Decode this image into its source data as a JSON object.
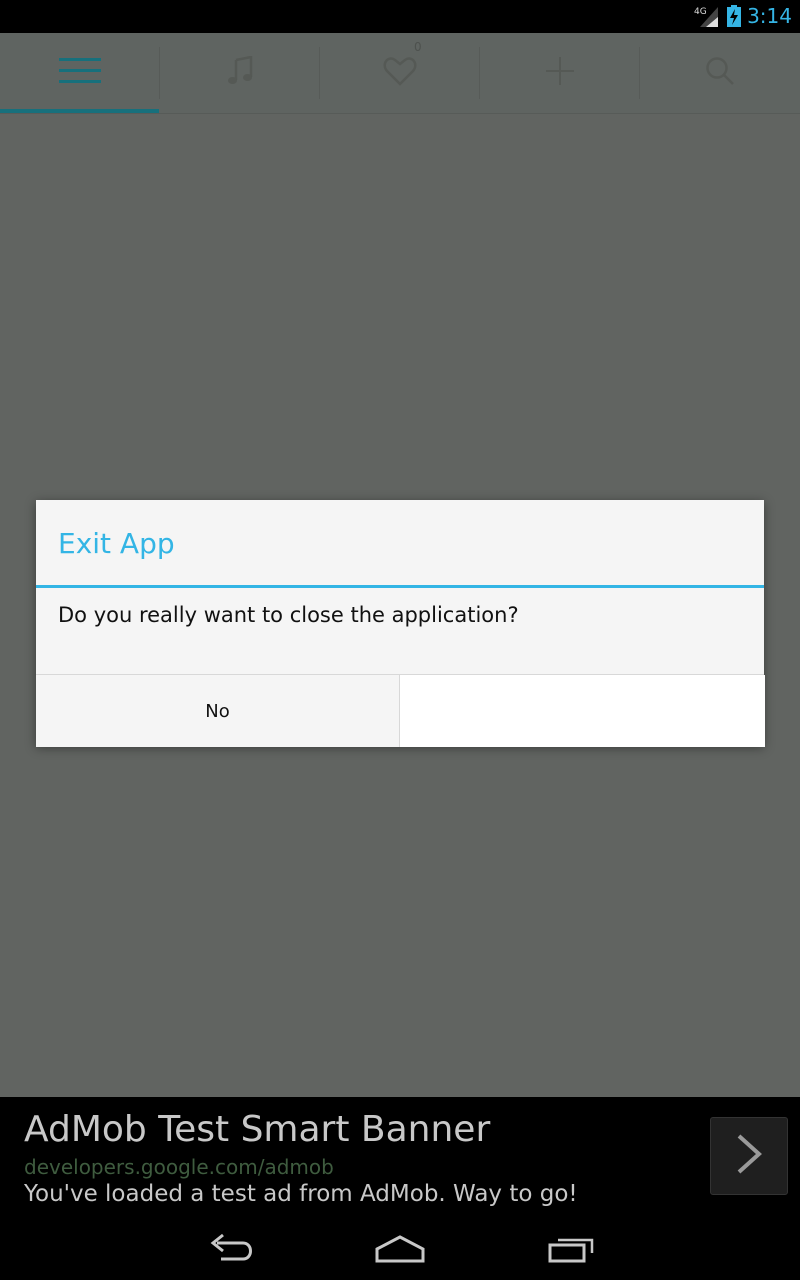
{
  "status_bar": {
    "time": "3:14",
    "network_label": "4G",
    "icons": [
      "signal-icon",
      "battery-charging-icon"
    ]
  },
  "tabs": [
    {
      "id": "menu",
      "icon": "menu-icon",
      "selected": true
    },
    {
      "id": "music",
      "icon": "music-note-icon",
      "selected": false
    },
    {
      "id": "favorites",
      "icon": "heart-icon",
      "selected": false,
      "badge": "0"
    },
    {
      "id": "add",
      "icon": "plus-icon",
      "selected": false
    },
    {
      "id": "search",
      "icon": "search-icon",
      "selected": false
    }
  ],
  "dialog": {
    "title": "Exit App",
    "message": "Do you really want to close the application?",
    "negative_label": "No",
    "positive_label": "",
    "accent_color": "#33b5e5"
  },
  "ad": {
    "title": "AdMob Test Smart Banner",
    "url": "developers.google.com/admob",
    "text": "You've loaded a test ad from AdMob. Way to go!",
    "arrow_icon": "chevron-right-icon"
  },
  "nav_bar": {
    "buttons": [
      "back-icon",
      "home-icon",
      "recents-icon"
    ]
  }
}
